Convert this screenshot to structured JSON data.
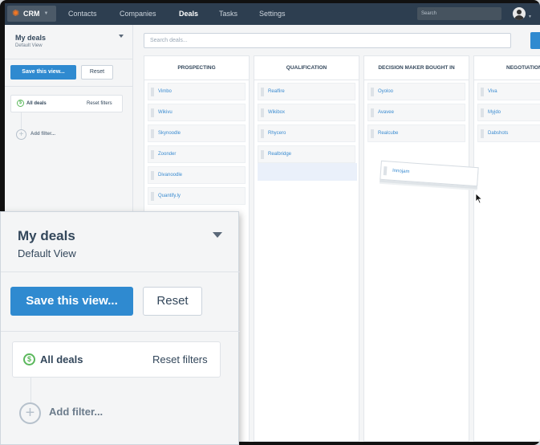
{
  "nav": {
    "brand": "CRM",
    "links": [
      "Contacts",
      "Companies",
      "Deals",
      "Tasks",
      "Settings"
    ],
    "active": "Deals",
    "search_placeholder": "Search",
    "brand_color": "#f57722",
    "nav_bg": "#2d3e50"
  },
  "sidebar": {
    "view_title": "My deals",
    "view_subtitle": "Default View",
    "save_label": "Save this view...",
    "reset_label": "Reset",
    "all_deals_label": "All deals",
    "reset_filters_label": "Reset filters",
    "add_filter_label": "Add filter..."
  },
  "main": {
    "search_placeholder": "Search deals...",
    "columns": [
      {
        "title": "PROSPECTING",
        "cards": [
          "Vimbo",
          "Wikivu",
          "Skynoodle",
          "Zoonder",
          "Divanoodle",
          "Quantify.ly"
        ]
      },
      {
        "title": "QUALIFICATION",
        "cards": [
          "Realfire",
          "Wikibox",
          "Rhycero",
          "Realbridge"
        ]
      },
      {
        "title": "DECISION MAKER BOUGHT IN",
        "cards": [
          "Oyoloo",
          "Avavee",
          "Realcube"
        ]
      },
      {
        "title": "NEGOTIATION",
        "cards": [
          "Viva",
          "Myjdo",
          "Dabshots"
        ]
      }
    ],
    "dragging_card": "Innojam"
  },
  "colors": {
    "primary_button": "#2f8ad0",
    "deal_link": "#3a8bd0",
    "dollar_icon": "#5bb85c"
  }
}
